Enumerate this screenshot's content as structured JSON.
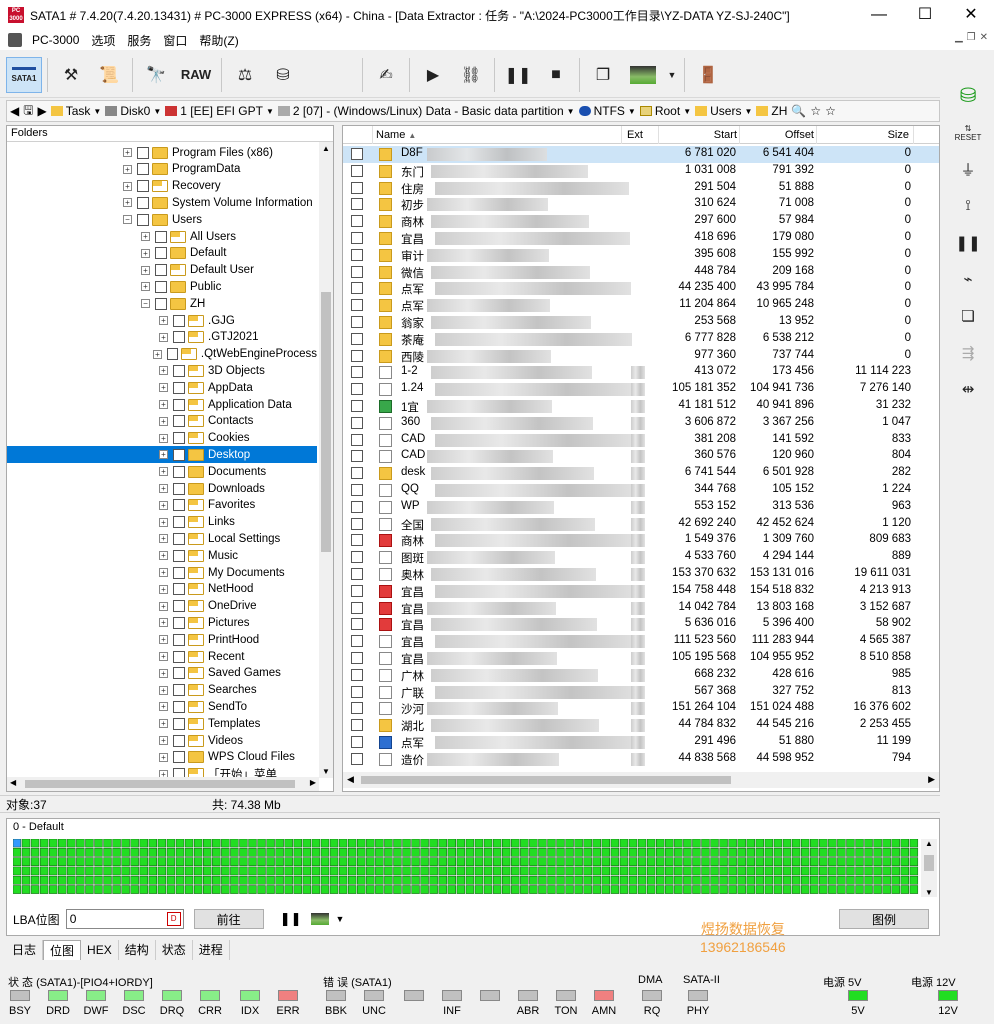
{
  "title": "SATA1 # 7.4.20(7.4.20.13431) # PC-3000 EXPRESS (x64) - China - [Data Extractor : 任务 - \"A:\\2024-PC3000工作目录\\YZ-DATA YZ-SJ-240C\"]",
  "app_icon_text": "PC 3000",
  "window_buttons": {
    "minimize": "—",
    "maximize": "☐",
    "close": "✕"
  },
  "menu": [
    "PC-3000",
    "选项",
    "服务",
    "窗口",
    "帮助(Z)"
  ],
  "toolbar": {
    "sata_label": "SATA1",
    "raw_label": "RAW"
  },
  "path": {
    "task": "Task",
    "disk": "Disk0",
    "part1": "1 [EE] EFI GPT",
    "part2": "2 [07] - (Windows/Linux) Data - Basic data partition",
    "fs": "NTFS",
    "root": "Root",
    "users": "Users",
    "zh": "ZH"
  },
  "folders_header": "Folders",
  "tree": [
    {
      "label": "Program Files (x86)",
      "level": 0,
      "icon": "folder"
    },
    {
      "label": "ProgramData",
      "level": 0,
      "icon": "folder"
    },
    {
      "label": "Recovery",
      "level": 0,
      "icon": "special"
    },
    {
      "label": "System Volume Information",
      "level": 0,
      "icon": "folder"
    },
    {
      "label": "Users",
      "level": 0,
      "icon": "folder",
      "expanded": true
    },
    {
      "label": "All Users",
      "level": 1,
      "icon": "special"
    },
    {
      "label": "Default",
      "level": 1,
      "icon": "folder"
    },
    {
      "label": "Default User",
      "level": 1,
      "icon": "special"
    },
    {
      "label": "Public",
      "level": 1,
      "icon": "folder"
    },
    {
      "label": "ZH",
      "level": 1,
      "icon": "folder",
      "expanded": true
    },
    {
      "label": ".GJG",
      "level": 2,
      "icon": "special"
    },
    {
      "label": ".GTJ2021",
      "level": 2,
      "icon": "special"
    },
    {
      "label": ".QtWebEngineProcess",
      "level": 2,
      "icon": "special"
    },
    {
      "label": "3D Objects",
      "level": 2,
      "icon": "special"
    },
    {
      "label": "AppData",
      "level": 2,
      "icon": "special"
    },
    {
      "label": "Application Data",
      "level": 2,
      "icon": "special"
    },
    {
      "label": "Contacts",
      "level": 2,
      "icon": "special"
    },
    {
      "label": "Cookies",
      "level": 2,
      "icon": "special"
    },
    {
      "label": "Desktop",
      "level": 2,
      "icon": "folder",
      "selected": true
    },
    {
      "label": "Documents",
      "level": 2,
      "icon": "folder"
    },
    {
      "label": "Downloads",
      "level": 2,
      "icon": "folder"
    },
    {
      "label": "Favorites",
      "level": 2,
      "icon": "special"
    },
    {
      "label": "Links",
      "level": 2,
      "icon": "special"
    },
    {
      "label": "Local Settings",
      "level": 2,
      "icon": "special"
    },
    {
      "label": "Music",
      "level": 2,
      "icon": "special"
    },
    {
      "label": "My Documents",
      "level": 2,
      "icon": "special"
    },
    {
      "label": "NetHood",
      "level": 2,
      "icon": "special"
    },
    {
      "label": "OneDrive",
      "level": 2,
      "icon": "special"
    },
    {
      "label": "Pictures",
      "level": 2,
      "icon": "special"
    },
    {
      "label": "PrintHood",
      "level": 2,
      "icon": "special"
    },
    {
      "label": "Recent",
      "level": 2,
      "icon": "special"
    },
    {
      "label": "Saved Games",
      "level": 2,
      "icon": "special"
    },
    {
      "label": "Searches",
      "level": 2,
      "icon": "special"
    },
    {
      "label": "SendTo",
      "level": 2,
      "icon": "special"
    },
    {
      "label": "Templates",
      "level": 2,
      "icon": "special"
    },
    {
      "label": "Videos",
      "level": 2,
      "icon": "special"
    },
    {
      "label": "WPS Cloud Files",
      "level": 2,
      "icon": "folder"
    },
    {
      "label": "「开始」菜单",
      "level": 2,
      "icon": "special"
    }
  ],
  "file_columns": {
    "name": "Name",
    "ext": "Ext",
    "start": "Start",
    "offset": "Offset",
    "size": "Size"
  },
  "files": [
    {
      "name": "D8F",
      "icon": "special",
      "start": "6 781 020",
      "offset": "6 541 404",
      "size": "0"
    },
    {
      "name": "东门",
      "icon": "folder",
      "start": "1 031 008",
      "offset": "791 392",
      "size": "0"
    },
    {
      "name": "住房",
      "icon": "folder",
      "start": "291 504",
      "offset": "51 888",
      "size": "0"
    },
    {
      "name": "初步",
      "icon": "folder",
      "start": "310 624",
      "offset": "71 008",
      "size": "0"
    },
    {
      "name": "商林",
      "icon": "folder",
      "start": "297 600",
      "offset": "57 984",
      "size": "0"
    },
    {
      "name": "宜昌",
      "icon": "folder",
      "start": "418 696",
      "offset": "179 080",
      "size": "0"
    },
    {
      "name": "审计",
      "icon": "folder",
      "start": "395 608",
      "offset": "155 992",
      "size": "0"
    },
    {
      "name": "微信",
      "icon": "folder",
      "start": "448 784",
      "offset": "209 168",
      "size": "0"
    },
    {
      "name": "点军",
      "icon": "folder",
      "start": "44 235 400",
      "offset": "43 995 784",
      "size": "0"
    },
    {
      "name": "点军",
      "icon": "folder",
      "start": "11 204 864",
      "offset": "10 965 248",
      "size": "0"
    },
    {
      "name": "翁家",
      "icon": "folder",
      "start": "253 568",
      "offset": "13 952",
      "size": "0"
    },
    {
      "name": "茶庵",
      "icon": "special",
      "start": "6 777 828",
      "offset": "6 538 212",
      "size": "0"
    },
    {
      "name": "西陵",
      "icon": "folder",
      "start": "977 360",
      "offset": "737 744",
      "size": "0"
    },
    {
      "name": "1-2",
      "icon": "file",
      "start": "413 072",
      "offset": "173 456",
      "size": "11 114 223"
    },
    {
      "name": "1.24",
      "icon": "file",
      "start": "105 181 352",
      "offset": "104 941 736",
      "size": "7 276 140"
    },
    {
      "name": "1宜",
      "icon": "green",
      "start": "41 181 512",
      "offset": "40 941 896",
      "size": "31 232"
    },
    {
      "name": "360",
      "icon": "file",
      "start": "3 606 872",
      "offset": "3 367 256",
      "size": "1 047"
    },
    {
      "name": "CAD",
      "icon": "file",
      "start": "381 208",
      "offset": "141 592",
      "size": "833"
    },
    {
      "name": "CAD",
      "icon": "file",
      "start": "360 576",
      "offset": "120 960",
      "size": "804"
    },
    {
      "name": "desk",
      "icon": "special",
      "start": "6 741 544",
      "offset": "6 501 928",
      "size": "282"
    },
    {
      "name": "QQ",
      "icon": "file",
      "start": "344 768",
      "offset": "105 152",
      "size": "1 224"
    },
    {
      "name": "WP",
      "icon": "file",
      "start": "553 152",
      "offset": "313 536",
      "size": "963"
    },
    {
      "name": "全国",
      "icon": "file",
      "start": "42 692 240",
      "offset": "42 452 624",
      "size": "1 120"
    },
    {
      "name": "商林",
      "icon": "red",
      "start": "1 549 376",
      "offset": "1 309 760",
      "size": "809 683"
    },
    {
      "name": "图斑",
      "icon": "file",
      "start": "4 533 760",
      "offset": "4 294 144",
      "size": "889"
    },
    {
      "name": "奥林",
      "icon": "file",
      "start": "153 370 632",
      "offset": "153 131 016",
      "size": "19 611 031"
    },
    {
      "name": "宜昌",
      "icon": "red",
      "start": "154 758 448",
      "offset": "154 518 832",
      "size": "4 213 913"
    },
    {
      "name": "宜昌",
      "icon": "red",
      "start": "14 042 784",
      "offset": "13 803 168",
      "size": "3 152 687"
    },
    {
      "name": "宜昌",
      "icon": "red",
      "start": "5 636 016",
      "offset": "5 396 400",
      "size": "58 902"
    },
    {
      "name": "宜昌",
      "icon": "file",
      "start": "111 523 560",
      "offset": "111 283 944",
      "size": "4 565 387"
    },
    {
      "name": "宜昌",
      "icon": "file",
      "start": "105 195 568",
      "offset": "104 955 952",
      "size": "8 510 858"
    },
    {
      "name": "广林",
      "icon": "file",
      "start": "668 232",
      "offset": "428 616",
      "size": "985"
    },
    {
      "name": "广联",
      "icon": "file",
      "start": "567 368",
      "offset": "327 752",
      "size": "813"
    },
    {
      "name": "沙河",
      "icon": "file",
      "start": "151 264 104",
      "offset": "151 024 488",
      "size": "16 376 602"
    },
    {
      "name": "湖北",
      "icon": "special",
      "start": "44 784 832",
      "offset": "44 545 216",
      "size": "2 253 455"
    },
    {
      "name": "点军",
      "icon": "blue",
      "start": "291 496",
      "offset": "51 880",
      "size": "11 199"
    },
    {
      "name": "造价",
      "icon": "file",
      "start": "44 838 568",
      "offset": "44 598 952",
      "size": "794"
    }
  ],
  "status": {
    "objects": "对象:37",
    "total": "共: 74.38 Mb"
  },
  "bitmap": {
    "title": "0 - Default",
    "lba_label": "LBA位图",
    "lba_value": "0",
    "go_button": "前往",
    "legend_button": "图例",
    "grid_color": "#22dd22",
    "first_cell_color": "#3399ff"
  },
  "watermark": {
    "line1": "煜扬数据恢复",
    "line2": "13962186546"
  },
  "tabs": [
    "日志",
    "位图",
    "HEX",
    "结构",
    "状态",
    "进程"
  ],
  "indicators": {
    "status_title": "状 态 (SATA1)-[PIO4+IORDY]",
    "error_title": "错 误 (SATA1)",
    "dma_title": "DMA",
    "sata2_title": "SATA-II",
    "power5_title": "电源 5V",
    "power12_title": "电源 12V",
    "leds": [
      {
        "label": "BSY",
        "color": "#c0c0c0"
      },
      {
        "label": "DRD",
        "color": "#88ee88"
      },
      {
        "label": "DWF",
        "color": "#88ee88"
      },
      {
        "label": "DSC",
        "color": "#88ee88"
      },
      {
        "label": "DRQ",
        "color": "#88ee88"
      },
      {
        "label": "CRR",
        "color": "#88ee88"
      },
      {
        "label": "IDX",
        "color": "#88ee88"
      },
      {
        "label": "ERR",
        "color": "#f08080"
      },
      {
        "label": "BBK",
        "color": "#c0c0c0"
      },
      {
        "label": "UNC",
        "color": "#c0c0c0"
      },
      {
        "label": "",
        "color": "#c0c0c0"
      },
      {
        "label": "INF",
        "color": "#c0c0c0"
      },
      {
        "label": "",
        "color": "#c0c0c0"
      },
      {
        "label": "ABR",
        "color": "#c0c0c0"
      },
      {
        "label": "TON",
        "color": "#c0c0c0"
      },
      {
        "label": "AMN",
        "color": "#f08080"
      },
      {
        "label": "RQ",
        "color": "#c0c0c0"
      },
      {
        "label": "PHY",
        "color": "#c0c0c0"
      },
      {
        "label": "5V",
        "color": "#22dd22"
      },
      {
        "label": "12V",
        "color": "#22dd22"
      }
    ]
  }
}
